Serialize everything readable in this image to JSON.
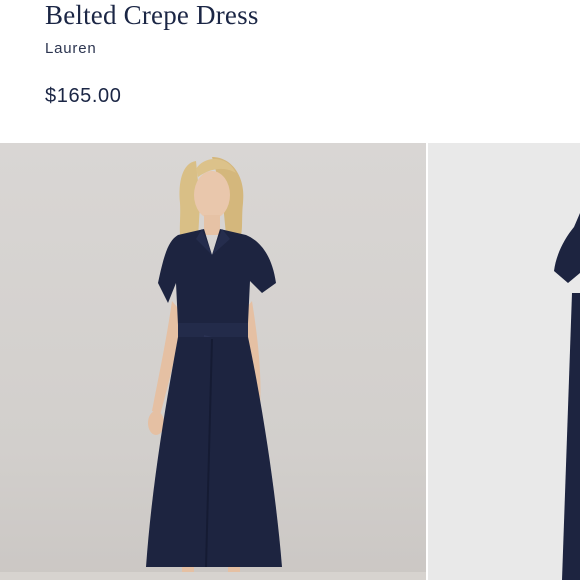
{
  "product": {
    "title": "Belted Crepe Dress",
    "brand": "Lauren",
    "price": "$165.00"
  },
  "gallery": {
    "images": [
      {
        "alt": "model-front-view"
      },
      {
        "alt": "dress-flat-view"
      }
    ]
  },
  "colors": {
    "text": "#1b2645",
    "dress": "#1d2440",
    "backdrop": "#d6d3d0"
  }
}
